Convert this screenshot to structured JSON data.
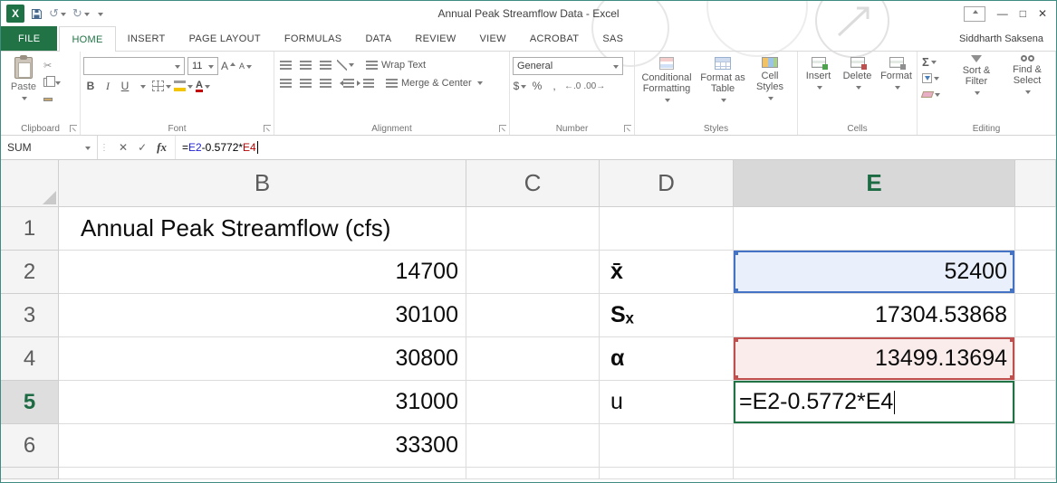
{
  "titlebar": {
    "title": "Annual Peak Streamflow Data - Excel",
    "user": "Siddharth Saksena"
  },
  "tabs": [
    {
      "label": "FILE"
    },
    {
      "label": "HOME"
    },
    {
      "label": "INSERT"
    },
    {
      "label": "PAGE LAYOUT"
    },
    {
      "label": "FORMULAS"
    },
    {
      "label": "DATA"
    },
    {
      "label": "REVIEW"
    },
    {
      "label": "VIEW"
    },
    {
      "label": "ACROBAT"
    },
    {
      "label": "SAS"
    }
  ],
  "icons": {
    "excel_logo": "X",
    "undo": "↺",
    "redo": "↻",
    "minimize": "—",
    "maximize": "□",
    "close": "✕",
    "cut": "✂",
    "bold": "B",
    "italic": "I",
    "underline": "U",
    "font_a": "A",
    "currency": "$",
    "percent": "%",
    "comma": ",",
    "increase_decimal": "←.0",
    "decrease_decimal": ".00→",
    "autosum": "Σ",
    "cancel": "✕",
    "enter": "✓",
    "fx": "fx",
    "splitter": "⋮"
  },
  "ribbon": {
    "clipboard": {
      "label": "Clipboard",
      "paste": "Paste"
    },
    "font": {
      "label": "Font",
      "name": "",
      "size": "11"
    },
    "alignment": {
      "label": "Alignment",
      "wrap_text": "Wrap Text",
      "merge_center": "Merge & Center"
    },
    "number": {
      "label": "Number",
      "format": "General"
    },
    "styles": {
      "label": "Styles",
      "conditional": "Conditional Formatting",
      "format_table": "Format as Table",
      "cell_styles": "Cell Styles"
    },
    "cells": {
      "label": "Cells",
      "insert": "Insert",
      "delete": "Delete",
      "format": "Format"
    },
    "editing": {
      "label": "Editing",
      "sort": "Sort & Filter",
      "find": "Find & Select"
    }
  },
  "formula_bar": {
    "name_box": "SUM",
    "formula": {
      "eq": "=",
      "ref1": "E2",
      "middle": "-0.5772*",
      "ref2": "E4"
    }
  },
  "grid": {
    "columns": [
      "B",
      "C",
      "D",
      "E"
    ],
    "rows": [
      "1",
      "2",
      "3",
      "4",
      "5",
      "6"
    ],
    "cells": {
      "B1": "Annual Peak Streamflow (cfs)",
      "B2": "14700",
      "B3": "30100",
      "B4": "30800",
      "B5": "31000",
      "B6": "33300",
      "D2": "x̄",
      "D3": "Sₓ",
      "D4": "α",
      "D5": "u",
      "E2": "52400",
      "E3": "17304.53868",
      "E4": "13499.13694",
      "E5": "=E2-0.5772*E4"
    }
  },
  "colors": {
    "accent_green": "#217346",
    "ref_blue": "#4472c4",
    "ref_red": "#c0504d",
    "formula_blue": "#1f1fd7",
    "formula_red": "#b80000"
  }
}
